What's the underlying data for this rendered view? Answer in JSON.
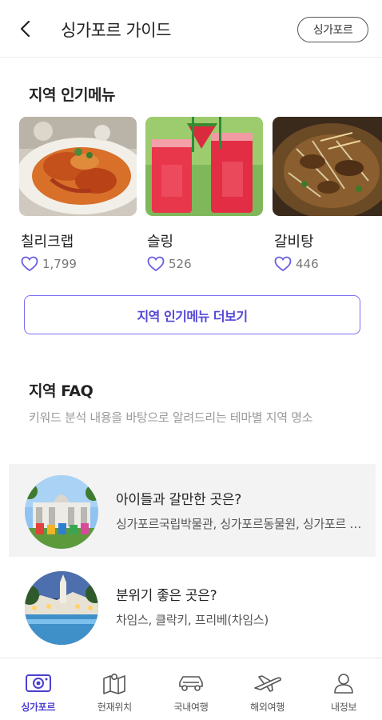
{
  "header": {
    "title": "싱가포르 가이드",
    "region_chip": "싱가포르"
  },
  "popular_menu": {
    "title": "지역 인기메뉴",
    "items": [
      {
        "name": "칠리크랩",
        "likes": "1,799"
      },
      {
        "name": "슬링",
        "likes": "526"
      },
      {
        "name": "갈비탕",
        "likes": "446"
      }
    ],
    "more_label": "지역 인기메뉴 더보기"
  },
  "faq": {
    "title": "지역 FAQ",
    "description": "키워드 분석 내용을 바탕으로 알려드리는 테마별 지역 명소",
    "items": [
      {
        "question": "아이들과 갈만한 곳은?",
        "answer": "싱가포르국립박물관, 싱가포르동물원, 싱가포르 보타닉 가든"
      },
      {
        "question": "분위기 좋은 곳은?",
        "answer": "차임스, 클락키, 프리베(차임스)"
      }
    ]
  },
  "bottom_nav": {
    "items": [
      {
        "label": "싱가포르",
        "icon": "camera-icon",
        "active": true
      },
      {
        "label": "현재위치",
        "icon": "map-icon",
        "active": false
      },
      {
        "label": "국내여행",
        "icon": "car-icon",
        "active": false
      },
      {
        "label": "해외여행",
        "icon": "airplane-icon",
        "active": false
      },
      {
        "label": "내정보",
        "icon": "person-icon",
        "active": false
      }
    ]
  },
  "colors": {
    "accent": "#5447d6",
    "accent_border": "#7b6ff0",
    "heart": "#6a5fe0"
  }
}
